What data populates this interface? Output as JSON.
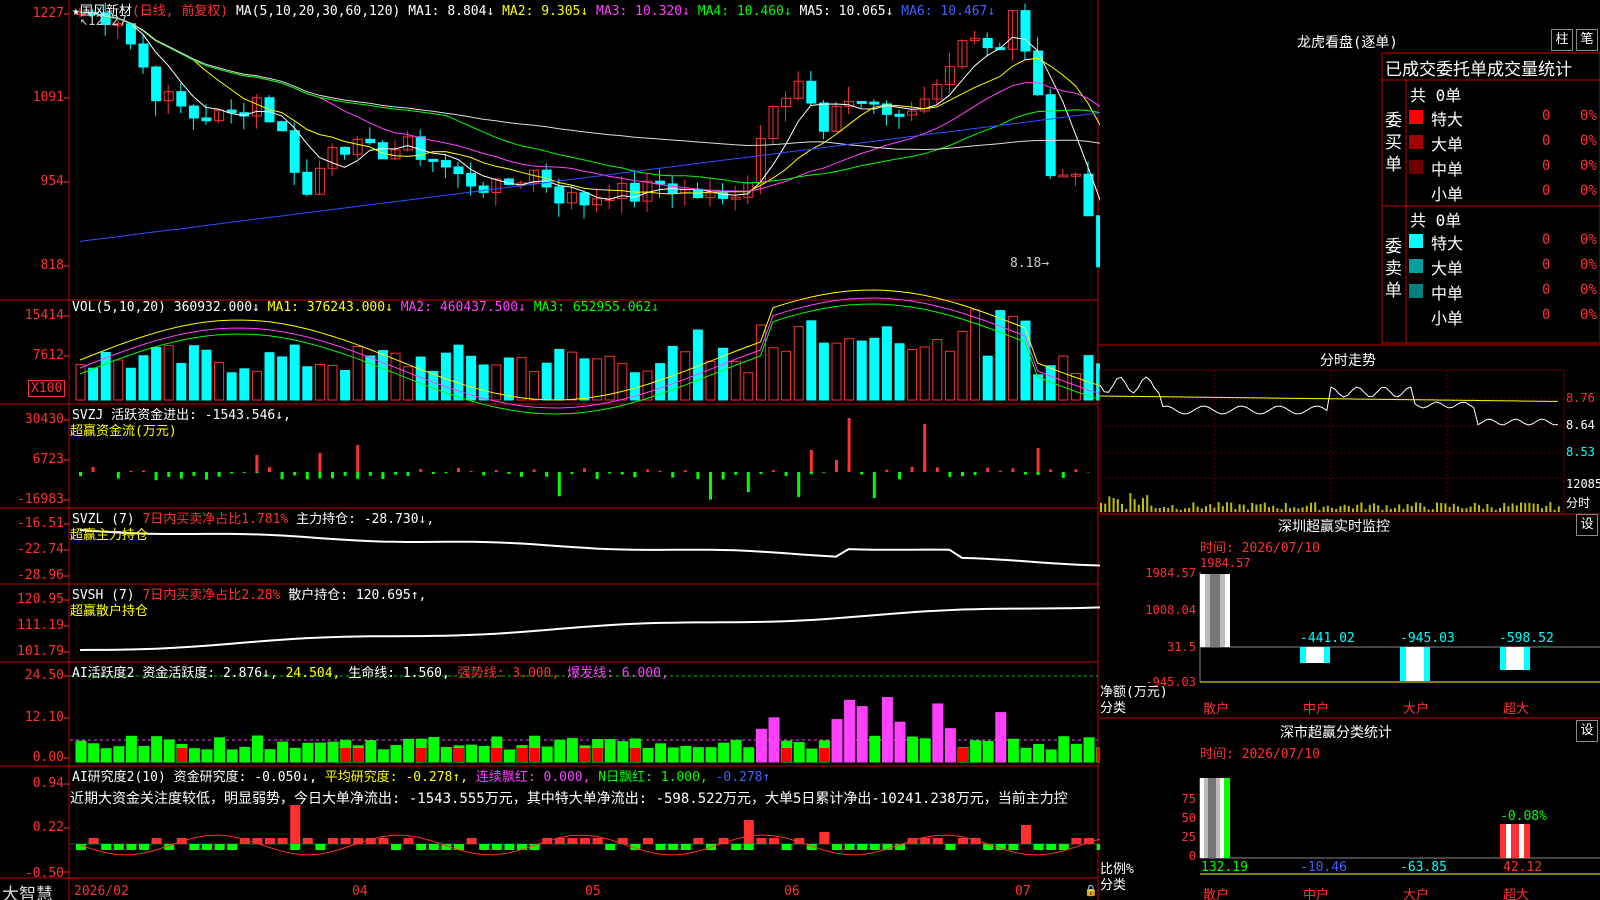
{
  "stock": {
    "star": "★",
    "name": "国风新材",
    "period": "(日线, 前复权)",
    "high_marker": "12.27",
    "low_marker": "8.18"
  },
  "ma": {
    "label": "MA(5,10,20,30,60,120)",
    "ma1": "MA1: 8.804↓",
    "ma2": "MA2: 9.305↓",
    "ma3": "MA3: 10.320↓",
    "ma4": "MA4: 10.460↓",
    "ma5": "MA5: 10.065↓",
    "ma6": "MA6: 10.467↓"
  },
  "price_axis": [
    "1227",
    "1091",
    "954",
    "818"
  ],
  "vol": {
    "label": "VOL(5,10,20)",
    "value": "360932.000↓",
    "ma1": "MA1: 376243.000↓",
    "ma2": "MA2: 460437.500↓",
    "ma3": "MA3: 652955.062↓",
    "axis": [
      "15414",
      "7612"
    ],
    "unit": "X100"
  },
  "svzj": {
    "label": "SVZJ",
    "text": "活跃资金进出: -1543.546↓,",
    "sub": "超赢资金流(万元)",
    "axis": [
      "30430",
      "6723",
      "-16983"
    ]
  },
  "svzl": {
    "label": "SVZL (7)",
    "text1": "7日内买卖净占比1.781%",
    "text2": "主力持仓: -28.730↓,",
    "sub": "超赢主力持仓",
    "axis": [
      "-16.51",
      "-22.74",
      "-28.96"
    ]
  },
  "svsh": {
    "label": "SVSH (7)",
    "text1": "7日内买卖净占比2.28%",
    "text2": "散户持仓: 120.695↑,",
    "sub": "超赢散户持仓",
    "axis": [
      "120.95",
      "111.19",
      "101.79"
    ]
  },
  "ai1": {
    "label": "AI活跃度2",
    "t1": "资金活跃度: 2.876↓,",
    "t2": "24.504,",
    "t3": "生命线: 1.560,",
    "t4": "强势线: 3.000,",
    "t5": "爆发线: 6.000,",
    "axis": [
      "24.50",
      "12.10",
      "0.00"
    ]
  },
  "ai2": {
    "label": "AI研究度2(10)",
    "t1": "资金研究度: -0.050↓,",
    "t2": "平均研究度: -0.278↑,",
    "t3": "连续飘红: 0.000,",
    "t4": "N日飘红: 1.000,",
    "t5": "-0.278↑",
    "desc": "近期大资金关注度较低，明显弱势，今日大单净流出: -1543.555万元，其中特大单净流出: -598.522万元，大单5日累计净出-10241.238万元，当前主力控",
    "axis": [
      "0.94",
      "0.22",
      "-0.50"
    ]
  },
  "x_axis": [
    "2026/02",
    "04",
    "05",
    "06",
    "07"
  ],
  "brand": "大智慧",
  "right_top": {
    "title": "龙虎看盘(逐单)",
    "btn1": "柱",
    "btn2": "笔",
    "header": "已成交委托单成交量统计",
    "buy_side": "委买单",
    "sell_side": "委卖单",
    "buy_total": "共 0单",
    "sell_total": "共 0单",
    "buy_rows": [
      {
        "name": "特大",
        "count": "0",
        "pct": "0%",
        "color": "#ff0000"
      },
      {
        "name": "大单",
        "count": "0",
        "pct": "0%",
        "color": "#a00000"
      },
      {
        "name": "中单",
        "count": "0",
        "pct": "0%",
        "color": "#700000"
      },
      {
        "name": "小单",
        "count": "0",
        "pct": "0%",
        "color": "#000000"
      }
    ],
    "sell_rows": [
      {
        "name": "特大",
        "count": "0",
        "pct": "0%",
        "color": "#00ffff"
      },
      {
        "name": "大单",
        "count": "0",
        "pct": "0%",
        "color": "#00a0a0"
      },
      {
        "name": "中单",
        "count": "0",
        "pct": "0%",
        "color": "#008080"
      },
      {
        "name": "小单",
        "count": "0",
        "pct": "0%",
        "color": "#000000"
      }
    ]
  },
  "intraday": {
    "title": "分时走势",
    "axis": [
      "8.76",
      "8.64",
      "8.53"
    ],
    "vol_label": "12085",
    "unit": "分时"
  },
  "monitor": {
    "title": "深圳超赢实时监控",
    "btn": "设",
    "time": "时间: 2026/07/10",
    "top_val": "1984.57",
    "axis": [
      "1984.57",
      "1008.04",
      "31.5",
      "-945.03"
    ],
    "values": [
      "-441.02",
      "-945.03",
      "-598.52"
    ],
    "ylabel": "净额(万元)",
    "xlabel": "分类",
    "cats": [
      "散户",
      "中户",
      "大户",
      "超大"
    ],
    "chart_data": {
      "type": "bar",
      "categories": [
        "散户",
        "中户",
        "大户",
        "超大"
      ],
      "values": [
        1984.57,
        -441.02,
        -945.03,
        -598.52
      ],
      "ylabel": "净额(万元)",
      "xlabel": "分类"
    }
  },
  "classify": {
    "title": "深市超赢分类统计",
    "btn": "设",
    "time": "时间: 2026/07/10",
    "axis": [
      "75",
      "50",
      "25",
      "0"
    ],
    "top_label": "-0.08%",
    "values": [
      "132.19",
      "-10.46",
      "-63.85",
      "42.12"
    ],
    "ylabel": "比例%",
    "xlabel": "分类",
    "cats": [
      "散户",
      "中户",
      "大户",
      "超大"
    ],
    "chart_data": {
      "type": "bar",
      "categories": [
        "散户",
        "中户",
        "大户",
        "超大"
      ],
      "values": [
        132.19,
        -10.46,
        -63.85,
        42.12
      ],
      "ylabel": "比例%",
      "xlabel": "分类"
    }
  }
}
